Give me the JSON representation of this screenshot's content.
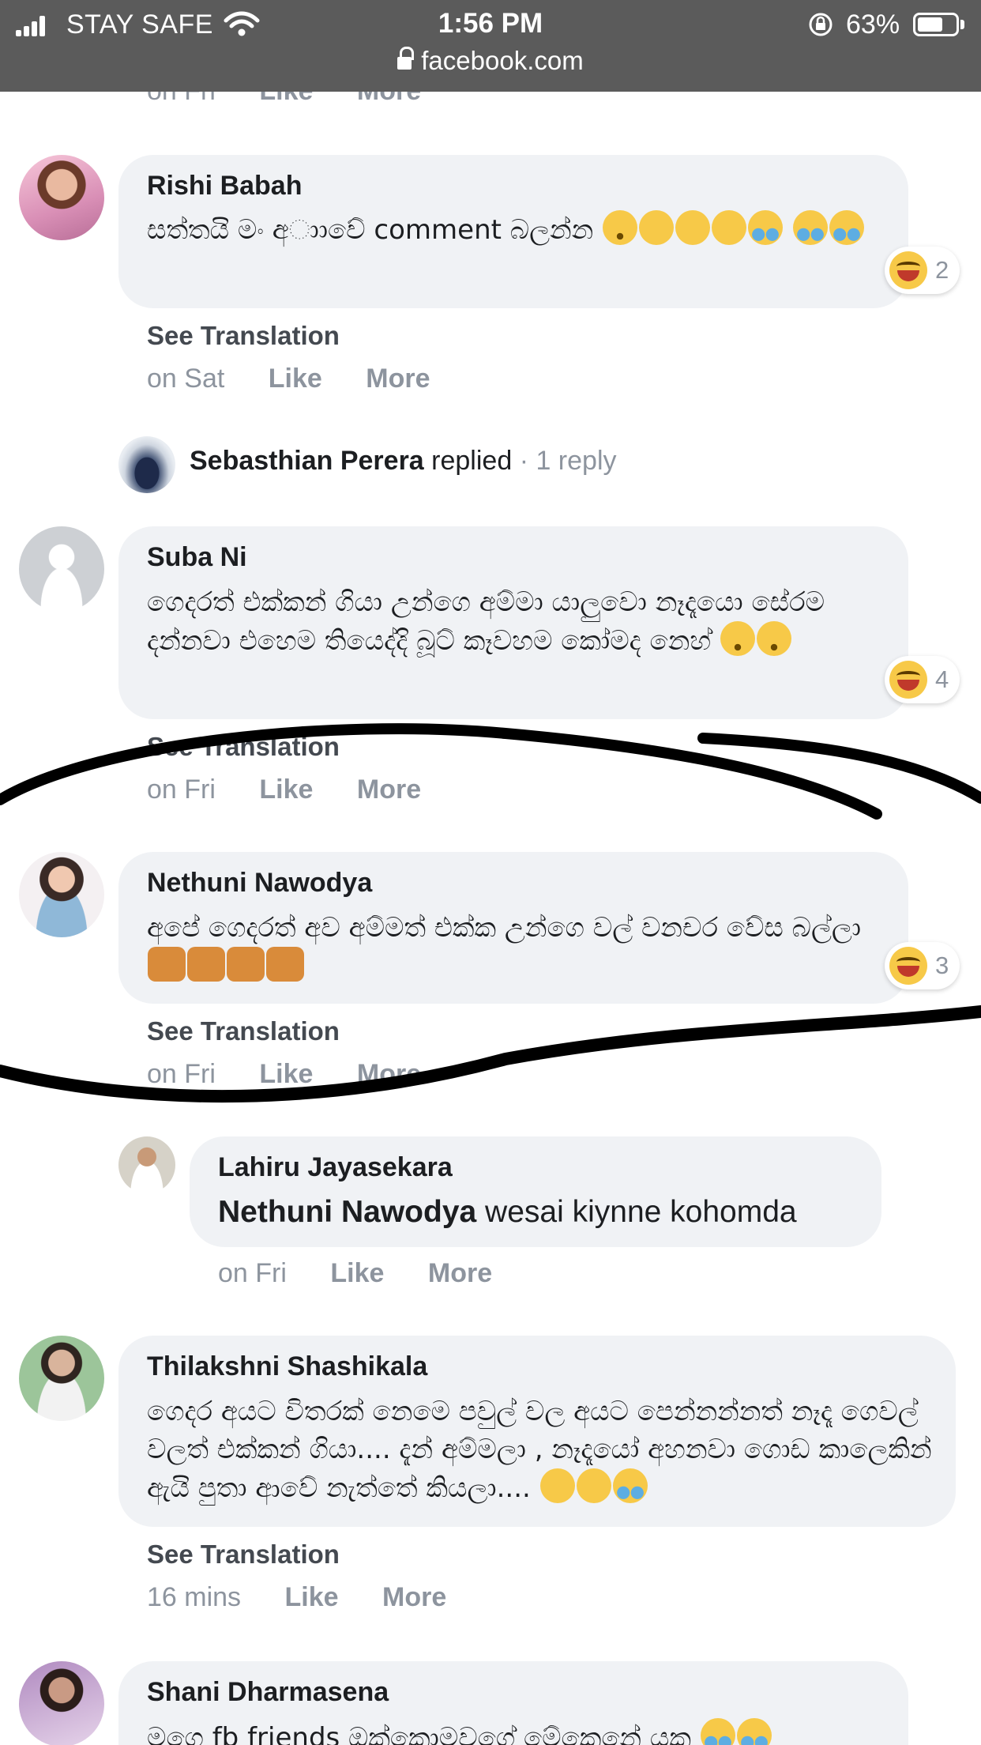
{
  "status_bar": {
    "carrier": "STAY SAFE",
    "time": "1:56 PM",
    "battery": "63%",
    "url": "facebook.com"
  },
  "prev_meta": {
    "time": "on Fri",
    "like": "Like",
    "more": "More"
  },
  "comments": [
    {
      "author": "Rishi Babah",
      "text": "සත්තයි මං අාාවේ comment බලන්න",
      "reactions": "2",
      "see_translation": "See Translation",
      "time": "on Sat",
      "like": "Like",
      "more": "More"
    },
    {
      "author": "Suba Ni",
      "text": "ගෙදරත් එක්කන් ගියා උන්ගෙ අම්මා යාලුවො නෑදෑයො සේරම දන්නවා එහෙම තියෙද්දි බූට් කෑවහම කෝමද නෙහ්",
      "reactions": "4",
      "see_translation": "See Translation",
      "time": "on Fri",
      "like": "Like",
      "more": "More"
    },
    {
      "author": "Nethuni Nawodya",
      "text": "අපේ ගෙදරත් අව අම්මත් එක්ක උන්ගෙ වල් වනචර වේස බල්ලා",
      "reactions": "3",
      "see_translation": "See Translation",
      "time": "on Fri",
      "like": "Like",
      "more": "More"
    },
    {
      "author": "Thilakshni Shashikala",
      "text": "ගෙදර අයට විතරක් නෙමෙ පවුල් වල අයට පෙන්නන්නත් නෑදෑ ගෙවල් වලත් එක්කන් ගියා.... දැන් අම්මලා , නෑදෑයෝ අහනවා ගොඩ කාලෙකින් ඇයි පුතා ආවේ නැත්තේ කියලා....",
      "see_translation": "See Translation",
      "time": "16 mins",
      "like": "Like",
      "more": "More"
    },
    {
      "author": "Shani Dharmasena",
      "text": "මගෙ fb friends ඔක්කොමවගේ මේකෙනේ යක"
    }
  ],
  "reply_summary": {
    "name": "Sebasthian Perera",
    "verb": "replied",
    "count": "· 1 reply"
  },
  "reply": {
    "author": "Lahiru Jayasekara",
    "mention": "Nethuni Nawodya",
    "text": "wesai kiynne kohomda",
    "time": "on Fri",
    "like": "Like",
    "more": "More"
  }
}
